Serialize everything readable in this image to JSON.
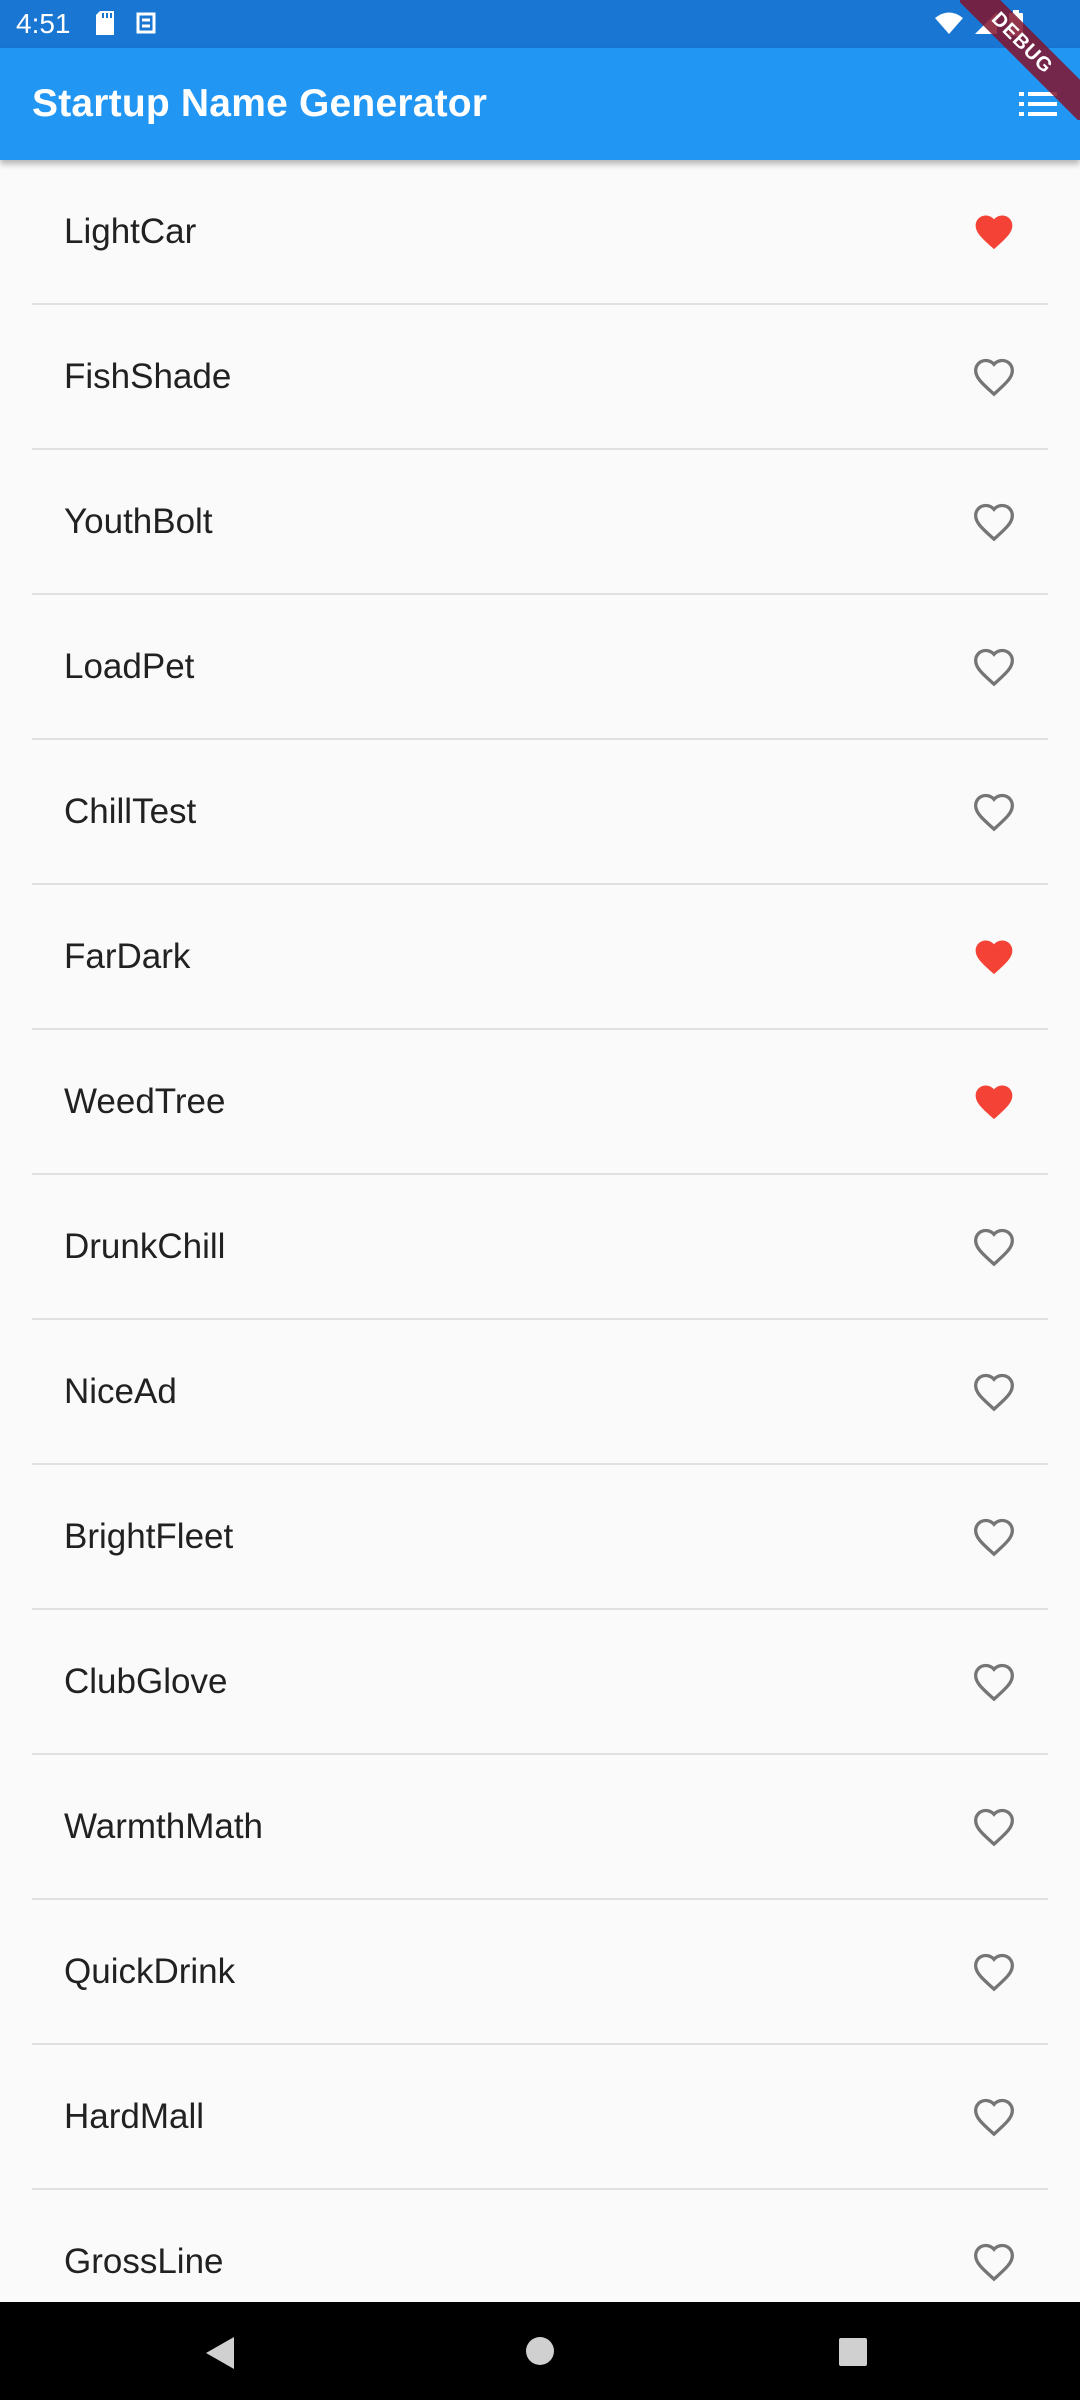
{
  "status_bar": {
    "time": "4:51",
    "left_icons": [
      "sd-card-icon",
      "sync-icon"
    ],
    "right_icons": [
      "wifi-icon",
      "signal-icon",
      "battery-icon"
    ]
  },
  "app_bar": {
    "title": "Startup Name Generator",
    "action_icon": "list-icon"
  },
  "debug_banner": "DEBUG",
  "colors": {
    "app_bar": "#2196f3",
    "status_bar": "#1976d2",
    "favorite": "#f44336",
    "not_favorite": "#757575"
  },
  "suggestions": [
    {
      "name": "LightCar",
      "favorited": true
    },
    {
      "name": "FishShade",
      "favorited": false
    },
    {
      "name": "YouthBolt",
      "favorited": false
    },
    {
      "name": "LoadPet",
      "favorited": false
    },
    {
      "name": "ChillTest",
      "favorited": false
    },
    {
      "name": "FarDark",
      "favorited": true
    },
    {
      "name": "WeedTree",
      "favorited": true
    },
    {
      "name": "DrunkChill",
      "favorited": false
    },
    {
      "name": "NiceAd",
      "favorited": false
    },
    {
      "name": "BrightFleet",
      "favorited": false
    },
    {
      "name": "ClubGlove",
      "favorited": false
    },
    {
      "name": "WarmthMath",
      "favorited": false
    },
    {
      "name": "QuickDrink",
      "favorited": false
    },
    {
      "name": "HardMall",
      "favorited": false
    },
    {
      "name": "GrossLine",
      "favorited": false
    }
  ],
  "nav_bar": [
    "back-icon",
    "home-icon",
    "recents-icon"
  ]
}
